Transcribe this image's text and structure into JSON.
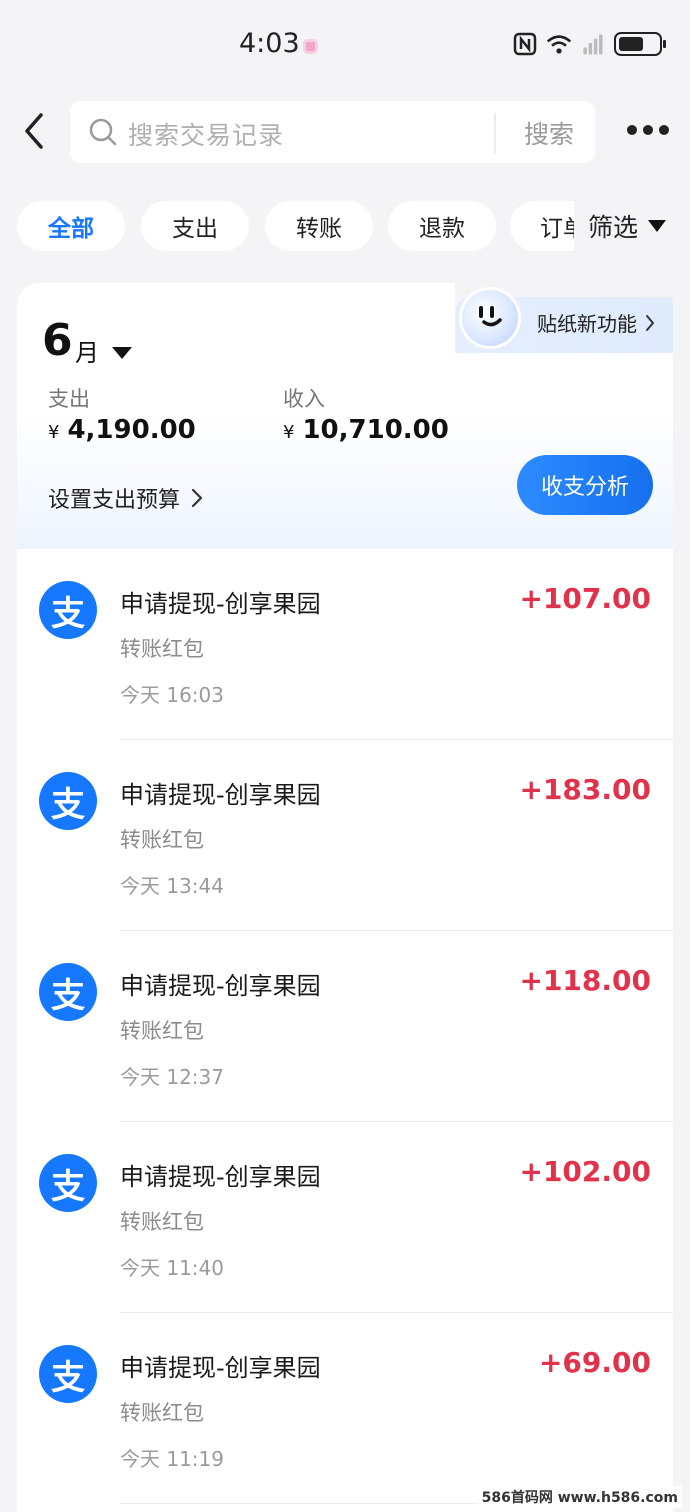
{
  "status_bar": {
    "time": "4:03"
  },
  "header": {
    "search_placeholder": "搜索交易记录",
    "search_button": "搜索"
  },
  "filters": {
    "chips": [
      "全部",
      "支出",
      "转账",
      "退款"
    ],
    "clipped_chip": "订单",
    "filter_label": "筛选"
  },
  "summary": {
    "sticker_label": "贴纸新功能",
    "month": "6",
    "month_unit": "月",
    "expense_label": "支出",
    "expense_currency": "¥",
    "expense_value": "4,190.00",
    "income_label": "收入",
    "income_currency": "¥",
    "income_value": "10,710.00",
    "budget_label": "设置支出预算",
    "analysis_button": "收支分析"
  },
  "transactions": [
    {
      "icon_char": "支",
      "title": "申请提现-创享果园",
      "sub": "转账红包",
      "time": "今天 16:03",
      "amount": "+107.00"
    },
    {
      "icon_char": "支",
      "title": "申请提现-创享果园",
      "sub": "转账红包",
      "time": "今天 13:44",
      "amount": "+183.00"
    },
    {
      "icon_char": "支",
      "title": "申请提现-创享果园",
      "sub": "转账红包",
      "time": "今天 12:37",
      "amount": "+118.00"
    },
    {
      "icon_char": "支",
      "title": "申请提现-创享果园",
      "sub": "转账红包",
      "time": "今天 11:40",
      "amount": "+102.00"
    },
    {
      "icon_char": "支",
      "title": "申请提现-创享果园",
      "sub": "转账红包",
      "time": "今天 11:19",
      "amount": "+69.00"
    }
  ],
  "colors": {
    "accent": "#1677ff",
    "income_amount": "#e0324a"
  },
  "watermark": "586首码网 www.h586.com"
}
